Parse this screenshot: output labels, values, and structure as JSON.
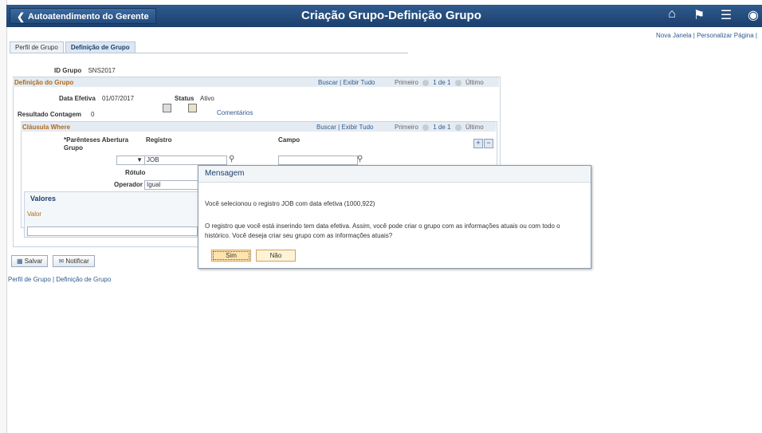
{
  "header": {
    "back_label": "Autoatendimento do Gerente",
    "title": "Criação Grupo-Definição Grupo",
    "icons": [
      "home-icon",
      "flag-icon",
      "menu-icon",
      "navbar-icon"
    ]
  },
  "toplinks": {
    "new_window": "Nova Janela",
    "separator": "|",
    "customize": "Personalizar Página",
    "separator2": "|"
  },
  "tabs": [
    {
      "label": "Perfil de Grupo"
    },
    {
      "label": "Definição de Grupo"
    }
  ],
  "group": {
    "id_label": "ID Grupo",
    "id_value": "SNS2017"
  },
  "definition": {
    "title": "Definição do Grupo",
    "find": "Buscar",
    "sep": "|",
    "view_all": "Exibir Tudo",
    "first": "Primeiro",
    "page": "1 de 1",
    "last": "Último",
    "eff_date_label": "Data Efetiva",
    "eff_date_value": "01/07/2017",
    "status_label": "Status",
    "status_value": "Ativo",
    "result_label": "Resultado Contagem",
    "result_value": "0",
    "comments": "Comentários"
  },
  "where": {
    "title": "Cláusula Where",
    "find": "Buscar",
    "sep": "|",
    "view_all": "Exibir Tudo",
    "first": "Primeiro",
    "page": "1 de 1",
    "last": "Último",
    "col_paren": "*Parênteses Abertura Grupo",
    "col_record": "Registro",
    "col_field": "Campo",
    "record_value": "JOB",
    "label_label": "Rótulo",
    "operator_label": "Operador",
    "operator_value": "Igual",
    "values_title": "Valores",
    "value_col": "Valor"
  },
  "actions": {
    "save": "Salvar",
    "notify": "Notificar"
  },
  "bottom_links": {
    "profile": "Perfil de Grupo",
    "sep": "|",
    "definition": "Definição de Grupo"
  },
  "dialog": {
    "title": "Mensagem",
    "line1": "Você selecionou o registro JOB com data efetiva (1000,922)",
    "line2": "O registro que você está inserindo tem data efetiva. Assim, você pode criar o grupo com as informações atuais ou com todo o",
    "line3": "histórico. Você deseja criar seu grupo com as informações atuais?",
    "yes": "Sim",
    "no": "Não"
  }
}
